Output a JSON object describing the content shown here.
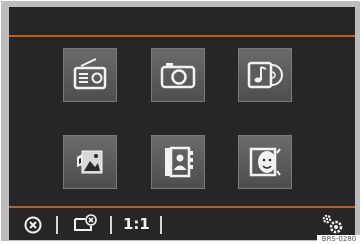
{
  "tiles": [
    {
      "name": "radio-icon"
    },
    {
      "name": "camera-icon"
    },
    {
      "name": "media-music-icon"
    },
    {
      "name": "picture-viewer-icon"
    },
    {
      "name": "phonebook-icon"
    },
    {
      "name": "face-contact-icon"
    }
  ],
  "bottom_bar": {
    "close_icon": "close-circle-icon",
    "picture_close_icon": "picture-close-icon",
    "aspect_ratio": "1:1",
    "settings_icon": "settings-gears-icon"
  },
  "image_code": "BRS-0280",
  "colors": {
    "screen_bg": "#262626",
    "accent_line": "#b8601e",
    "tile_bg": "#5c5c5c",
    "icon_fg": "#f2f2f2"
  }
}
